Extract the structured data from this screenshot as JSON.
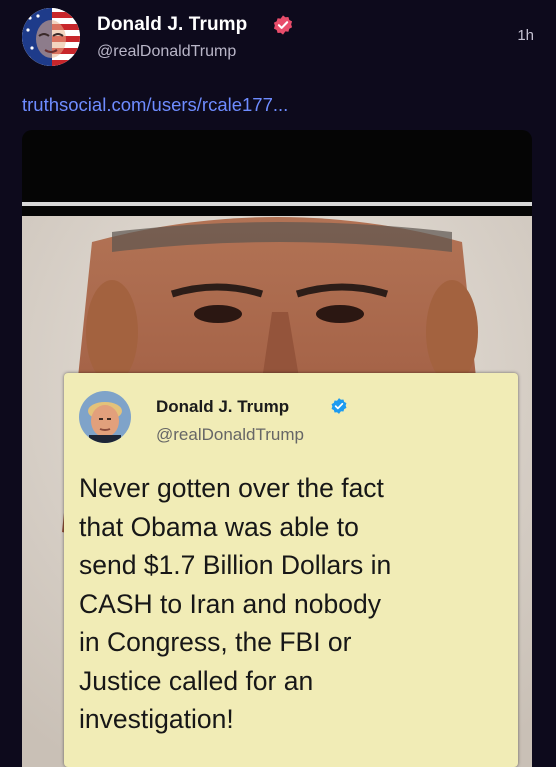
{
  "post": {
    "display_name": "Donald J. Trump",
    "handle": "@realDonaldTrump",
    "time": "1h",
    "link": "truthsocial.com/users/rcale177..."
  },
  "embedded_tweet": {
    "display_name": "Donald J. Trump",
    "handle": "@realDonaldTrump",
    "text": "Never gotten over the fact\nthat Obama was able to\nsend $1.7 Billion Dollars in\nCASH to Iran and nobody\nin Congress, the FBI or\nJustice called for an\ninvestigation!"
  },
  "colors": {
    "background": "#0d0a1c",
    "link": "#6e8cff",
    "verified_badge_post": "#e84d6b",
    "verified_badge_tweet": "#1d9bf0",
    "card_background": "#f1ecb6"
  },
  "icons": {
    "post_verified": "verified-check-icon",
    "tweet_verified": "verified-check-icon"
  }
}
